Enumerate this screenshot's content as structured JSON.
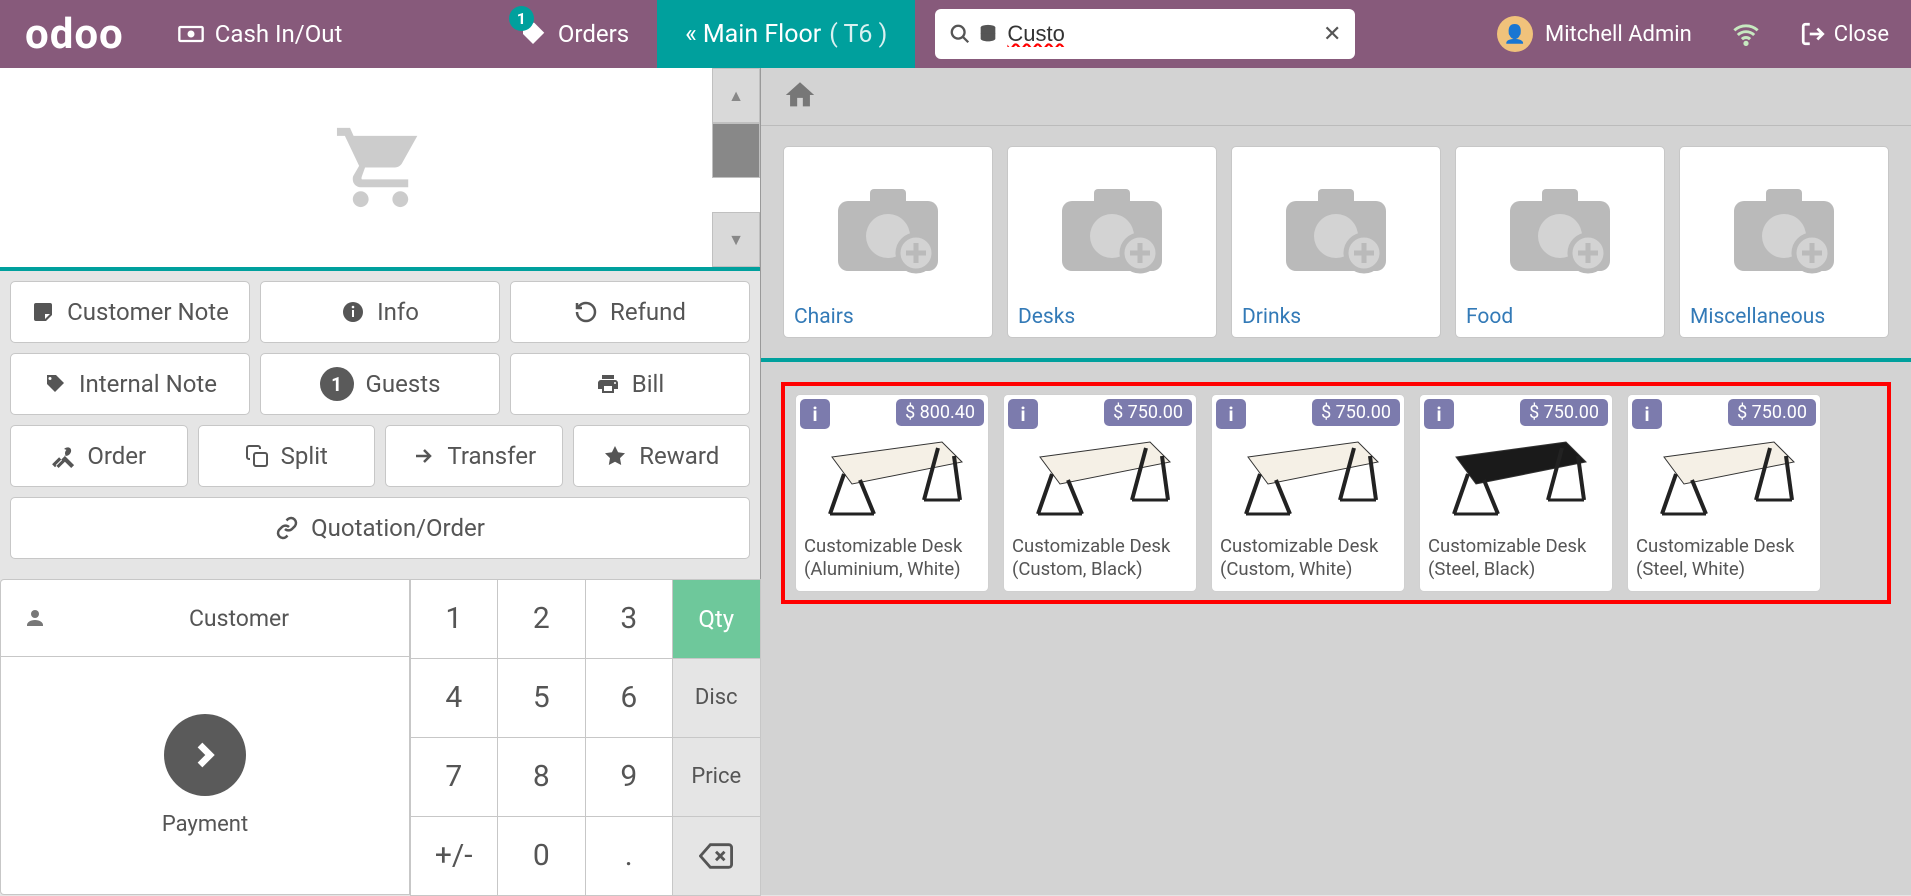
{
  "header": {
    "logo": "odoo",
    "cash": "Cash In/Out",
    "orders": "Orders",
    "orders_badge": "1",
    "floor_prefix": "«",
    "floor_name": "Main Floor",
    "floor_table": "( T6 )",
    "search_value": "Custo",
    "user_name": "Mitchell Admin",
    "close": "Close"
  },
  "controls": {
    "customer_note": "Customer Note",
    "info": "Info",
    "refund": "Refund",
    "internal_note": "Internal Note",
    "guests": "Guests",
    "guests_count": "1",
    "bill": "Bill",
    "order": "Order",
    "split": "Split",
    "transfer": "Transfer",
    "reward": "Reward",
    "quotation": "Quotation/Order"
  },
  "customer_btn": "Customer",
  "payment_label": "Payment",
  "numpad": {
    "qty": "Qty",
    "disc": "Disc",
    "price": "Price",
    "k1": "1",
    "k2": "2",
    "k3": "3",
    "k4": "4",
    "k5": "5",
    "k6": "6",
    "k7": "7",
    "k8": "8",
    "k9": "9",
    "k0": "0",
    "pm": "+/-",
    "dot": "."
  },
  "categories": [
    {
      "label": "Chairs"
    },
    {
      "label": "Desks"
    },
    {
      "label": "Drinks"
    },
    {
      "label": "Food"
    },
    {
      "label": "Miscellaneous"
    }
  ],
  "products": [
    {
      "price": "$ 800.40",
      "name": "Customizable Desk (Aluminium, White)",
      "dark": false
    },
    {
      "price": "$ 750.00",
      "name": "Customizable Desk (Custom, Black)",
      "dark": false
    },
    {
      "price": "$ 750.00",
      "name": "Customizable Desk (Custom, White)",
      "dark": false
    },
    {
      "price": "$ 750.00",
      "name": "Customizable Desk (Steel, Black)",
      "dark": true
    },
    {
      "price": "$ 750.00",
      "name": "Customizable Desk (Steel, White)",
      "dark": false
    }
  ]
}
